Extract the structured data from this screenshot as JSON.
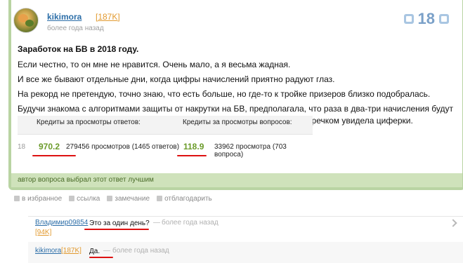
{
  "answer": {
    "author": "kikimora",
    "author_rating": "[187K]",
    "timestamp": "более года назад",
    "votes": "18",
    "title": "Заработок на БВ в 2018 году.",
    "paragraphs": [
      "Если честно, то он мне не нравится. Очень мало, а я весьма жадная.",
      "И все же бывают отдельные дни, когда цифры начислений приятно радуют глаз.",
      "На рекорд не претендую, точно знаю, что есть больше, но где-то к тройке призеров близко подобралась.",
      "Будучи знакома с алгоритмами защиты от накрутки на БВ, предполагала, что раза в два-три начисления будут выше обычных. Поэтому, на пару секунд глаза вылетели из орбит, когда утречком увидела циферки."
    ],
    "stats": {
      "header_answers": "Кредиты за просмотры ответов:",
      "header_questions": "Кредиты за просмотры вопросов:",
      "row_number": "18",
      "credits_answers": "970.2",
      "views_answers": "279456 просмотров (1465 ответов)",
      "credits_questions": "118.9",
      "views_questions": "33962 просмотра (703 вопроса)"
    },
    "best_label": "автор вопроса выбрал этот ответ лучшим",
    "actions": [
      "в избранное",
      "ссылка",
      "замечание",
      "отблагодарить"
    ]
  },
  "comments": [
    {
      "user": "Владимир09854",
      "rating": "[94K]",
      "text": "Это за один день?",
      "dash": "—",
      "time": "более года назад"
    },
    {
      "user": "kikimora",
      "rating": "[187K]",
      "text": "Да.",
      "dash": "—",
      "time": "более года назад"
    }
  ],
  "colors": {
    "frame_green": "#b9d4a3",
    "best_bar": "#cfe2bb",
    "credit_green": "#6b9b2a",
    "link_blue": "#2c6ea8",
    "rating_orange": "#e29a2f",
    "annotation_red": "#dd1111"
  }
}
